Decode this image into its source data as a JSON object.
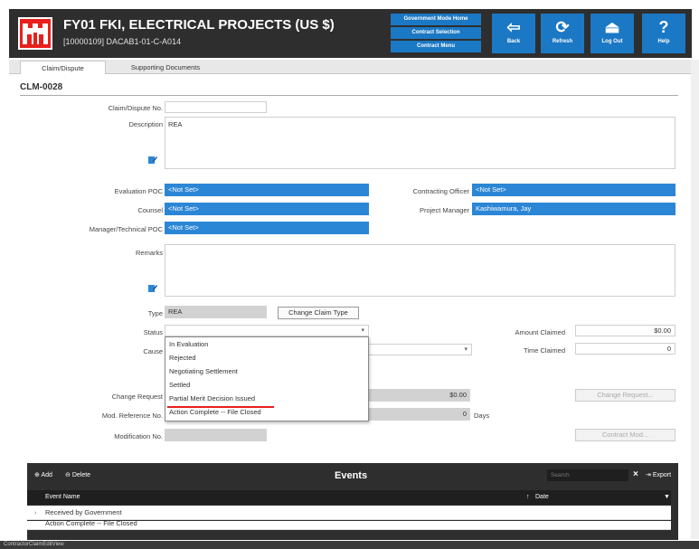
{
  "header": {
    "title": "FY01 FKI, ELECTRICAL PROJECTS (US $)",
    "subtitle": "[10000109] DACAB1-01-C-A014",
    "links": [
      "Government Mode Home",
      "Contract Selection",
      "Contract Menu"
    ],
    "buttons": {
      "back": "Back",
      "refresh": "Refresh",
      "logout": "Log Out",
      "help": "Help"
    },
    "colors": {
      "bar": "#2e2e2e",
      "accent": "#1b78c4",
      "logo": "#e8201d"
    }
  },
  "tabs": [
    "Claim/Dispute",
    "Supporting Documents"
  ],
  "form": {
    "record_id": "CLM-0028",
    "claim_no_label": "Claim/Dispute No.",
    "claim_no_value": "",
    "description_label": "Description",
    "description_value": "REA",
    "evaluation_poc_label": "Evaluation POC",
    "evaluation_poc_value": "<Not Set>",
    "counsel_label": "Counsel",
    "counsel_value": "<Not Set>",
    "manager_poc_label": "Manager/Technical POC",
    "manager_poc_value": "<Not Set>",
    "contracting_officer_label": "Contracting Officer",
    "contracting_officer_value": "<Not Set>",
    "project_manager_label": "Project Manager",
    "project_manager_value": "Kashiwamura, Jay",
    "remarks_label": "Remarks",
    "type_label": "Type",
    "type_value": "REA",
    "change_type_button": "Change Claim Type",
    "status_label": "Status",
    "status_value": "",
    "cause_label": "Cause",
    "amount_claimed_label": "Amount Claimed",
    "amount_claimed_value": "$0.00",
    "time_claimed_label": "Time Claimed",
    "time_claimed_value": "0",
    "change_request_label": "Change Request",
    "change_request_value": "$0.00",
    "change_request_button": "Change Request...",
    "mod_ref_label": "Mod. Reference No.",
    "mod_ref_value": "0",
    "mod_ref_unit": "Days",
    "modification_label": "Modification No.",
    "contract_mod_button": "Contract Mod..."
  },
  "status_dropdown": {
    "options": [
      "In Evaluation",
      "Rejected",
      "Negotiating Settlement",
      "Settled",
      "Partial Merit Decision Issued",
      "Action Complete -- File Closed"
    ],
    "highlighted": "Partial Merit Decision Issued"
  },
  "events": {
    "add_label": "Add",
    "delete_label": "Delete",
    "title": "Events",
    "search_placeholder": "Search",
    "export_label": "Export",
    "columns": [
      "Event Name",
      "Date"
    ],
    "rows": [
      "Received by Government",
      "Action Complete -- File Closed"
    ]
  },
  "statusbar": "ContractorClaimEditView"
}
